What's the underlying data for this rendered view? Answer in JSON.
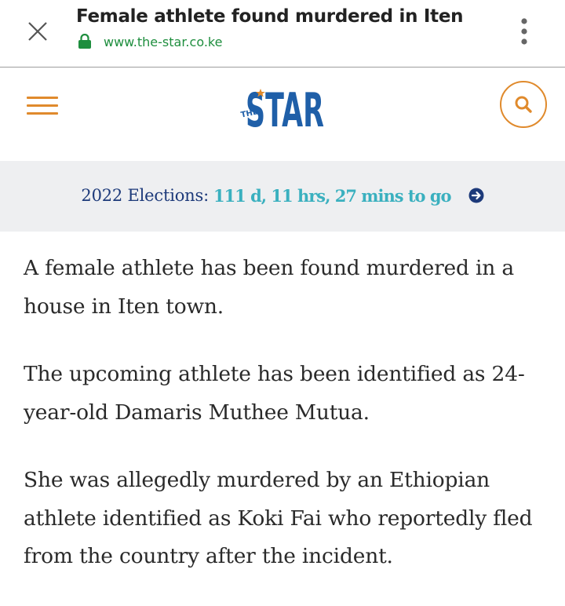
{
  "browser": {
    "title": "Female athlete found murdered in Iten",
    "url": "www.the-star.co.ke"
  },
  "header": {
    "logo_small": "THE",
    "logo_large": "STAR",
    "accent_color": "#e08a2c",
    "logo_color": "#1f5fa8"
  },
  "election": {
    "label": "2022 Elections:",
    "countdown": "111 d, 11 hrs, 27 mins to go"
  },
  "article": {
    "paragraphs": [
      "A female athlete has been found murdered in a house in Iten town.",
      "The upcoming athlete has been identified as 24-year-old Damaris Muthee Mutua.",
      "She was allegedly murdered by an Ethiopian athlete identified as Koki Fai who reportedly fled from the country after the incident."
    ]
  }
}
